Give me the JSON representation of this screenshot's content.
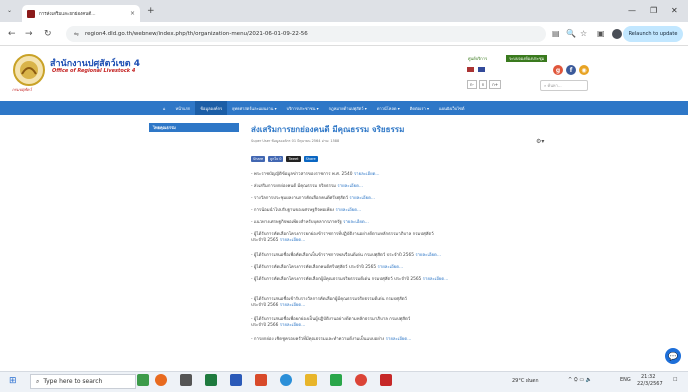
{
  "browser": {
    "tab_title": "การส่งเสริมและยกย่องคนดี...",
    "url": "region4.dld.go.th/webnew/index.php/th/organization-menu/2021-06-01-09-22-56",
    "relaunch_label": "Relaunch to update"
  },
  "site": {
    "title": "สำนักงานปศุสัตว์เขต 4",
    "subtitle": "Office of Regional Livestock 4",
    "logo_caption": "กรมปศุสัตว์",
    "top_link_1": "ศูนย์บริการ",
    "top_link_2": "ระบบจองห้องประชุม",
    "font_sizes": [
      "ก-",
      "ก",
      "ก+"
    ],
    "search_placeholder": "ค้นหา..."
  },
  "nav": [
    {
      "label": "หน้าแรก",
      "active": false
    },
    {
      "label": "ข้อมูลองค์กร",
      "active": true
    },
    {
      "label": "ยุทธศาสตร์และแผนงาน ▾",
      "active": false
    },
    {
      "label": "บริการประชาชน ▾",
      "active": false
    },
    {
      "label": "กฎหมายด้านปศุสัตว์ ▾",
      "active": false
    },
    {
      "label": "ดาวน์โหลด ▾",
      "active": false
    },
    {
      "label": "ติดต่อเรา ▾",
      "active": false
    },
    {
      "label": "แผนผังเว็บไซต์",
      "active": false
    }
  ],
  "sidebar": {
    "heading": "ไทยคุณธรรม"
  },
  "article": {
    "title": "ส่งเสริมการยกย่องคนดี มีคุณธรรม จริยธรรม",
    "meta": "Super User   ข้อมูลองค์กร   01 มิถุนายน 2564   อ่าน: 1588",
    "share_buttons": [
      "Share",
      "ถูกใจ 0",
      "Tweet",
      "Share"
    ],
    "items": [
      {
        "text": "- พระราชบัญญัติข้อมูลข่าวสารของราชการ พ.ศ. 2540",
        "more": "รายละเอียด..."
      },
      {
        "text": "- ส่งเสริมการยกย่องคนดี มีคุณธรรม จริยธรรม",
        "more": "รายละเอียด..."
      },
      {
        "text": "- รางวัลการประชุมผลงานการคัดเลือกคนดีศรีปศุสัตว์",
        "more": "รายละเอียด..."
      },
      {
        "text": "- การน้อมนำไปปรับฐานของเศรษฐกิจพอเพียง",
        "more": "รายละเอียด..."
      },
      {
        "text": "- แนวทางเศรษฐกิจพอเพียงสำหรับบุคลากรภาครัฐ",
        "more": "รายละเอียด..."
      },
      {
        "text": "- ผู้ได้รับการคัดเลือกโครงการยกย่องข้าราชการที่ปฏิบัติงานอย่างดีตามหลักธรรมาภิบาล กรมปศุสัตว์",
        "more": ""
      },
      {
        "text": "  ประจำปี 2565",
        "more": "รายละเอียด..."
      },
      {
        "text": "- ผู้ได้รับการเสนอชื่อเพื่อคัดเลือกเป็นข้าราชการพลเรือนดีเด่น กรมปศุสัตว์ ประจำปี 2565",
        "more": "รายละเอียด..."
      },
      {
        "text": "- ผู้ได้รับการคัดเลือกโครงการคัดเลือกคนดีศรีปศุสัตว์ ประจำปี 2565",
        "more": "รายละเอียด..."
      },
      {
        "text": "- ผู้ได้รับการคัดเลือกโครงการคัดเลือกผู้มีคุณธรรมจริยธรรมดีเด่น กรมปศุสัตว์ ประจำปี 2565",
        "more": "รายละเอียด..."
      },
      {
        "text": "- ผู้ได้รับการเสนอชื่อเข้ารับรางวัลการคัดเลือกผู้มีคุณธรรมจริยธรรมดีเด่น กรมปศุสัตว์",
        "more": ""
      },
      {
        "text": "  ประจำปี 2566",
        "more": "รายละเอียด..."
      },
      {
        "text": "- ผู้ได้รับการเสนอชื่อเพื่อยกย่องเป็นผู้ปฏิบัติงานอย่างดีตามหลักธรรมาภิบาล กรมปศุสัตว์",
        "more": ""
      },
      {
        "text": "  ประจำปี 2566",
        "more": "รายละเอียด..."
      },
      {
        "text": "- การยกย่อง เชิดชูครอบครัวที่มีคุณธรรมและทำความดีงามเป็นแบบอย่าง",
        "more": "รายละเอียด..."
      }
    ]
  },
  "taskbar": {
    "search_placeholder": "Type here to search",
    "weather": "29°C ฝนตก",
    "lang": "ENG",
    "time": "21:32",
    "date": "22/3/2567"
  }
}
